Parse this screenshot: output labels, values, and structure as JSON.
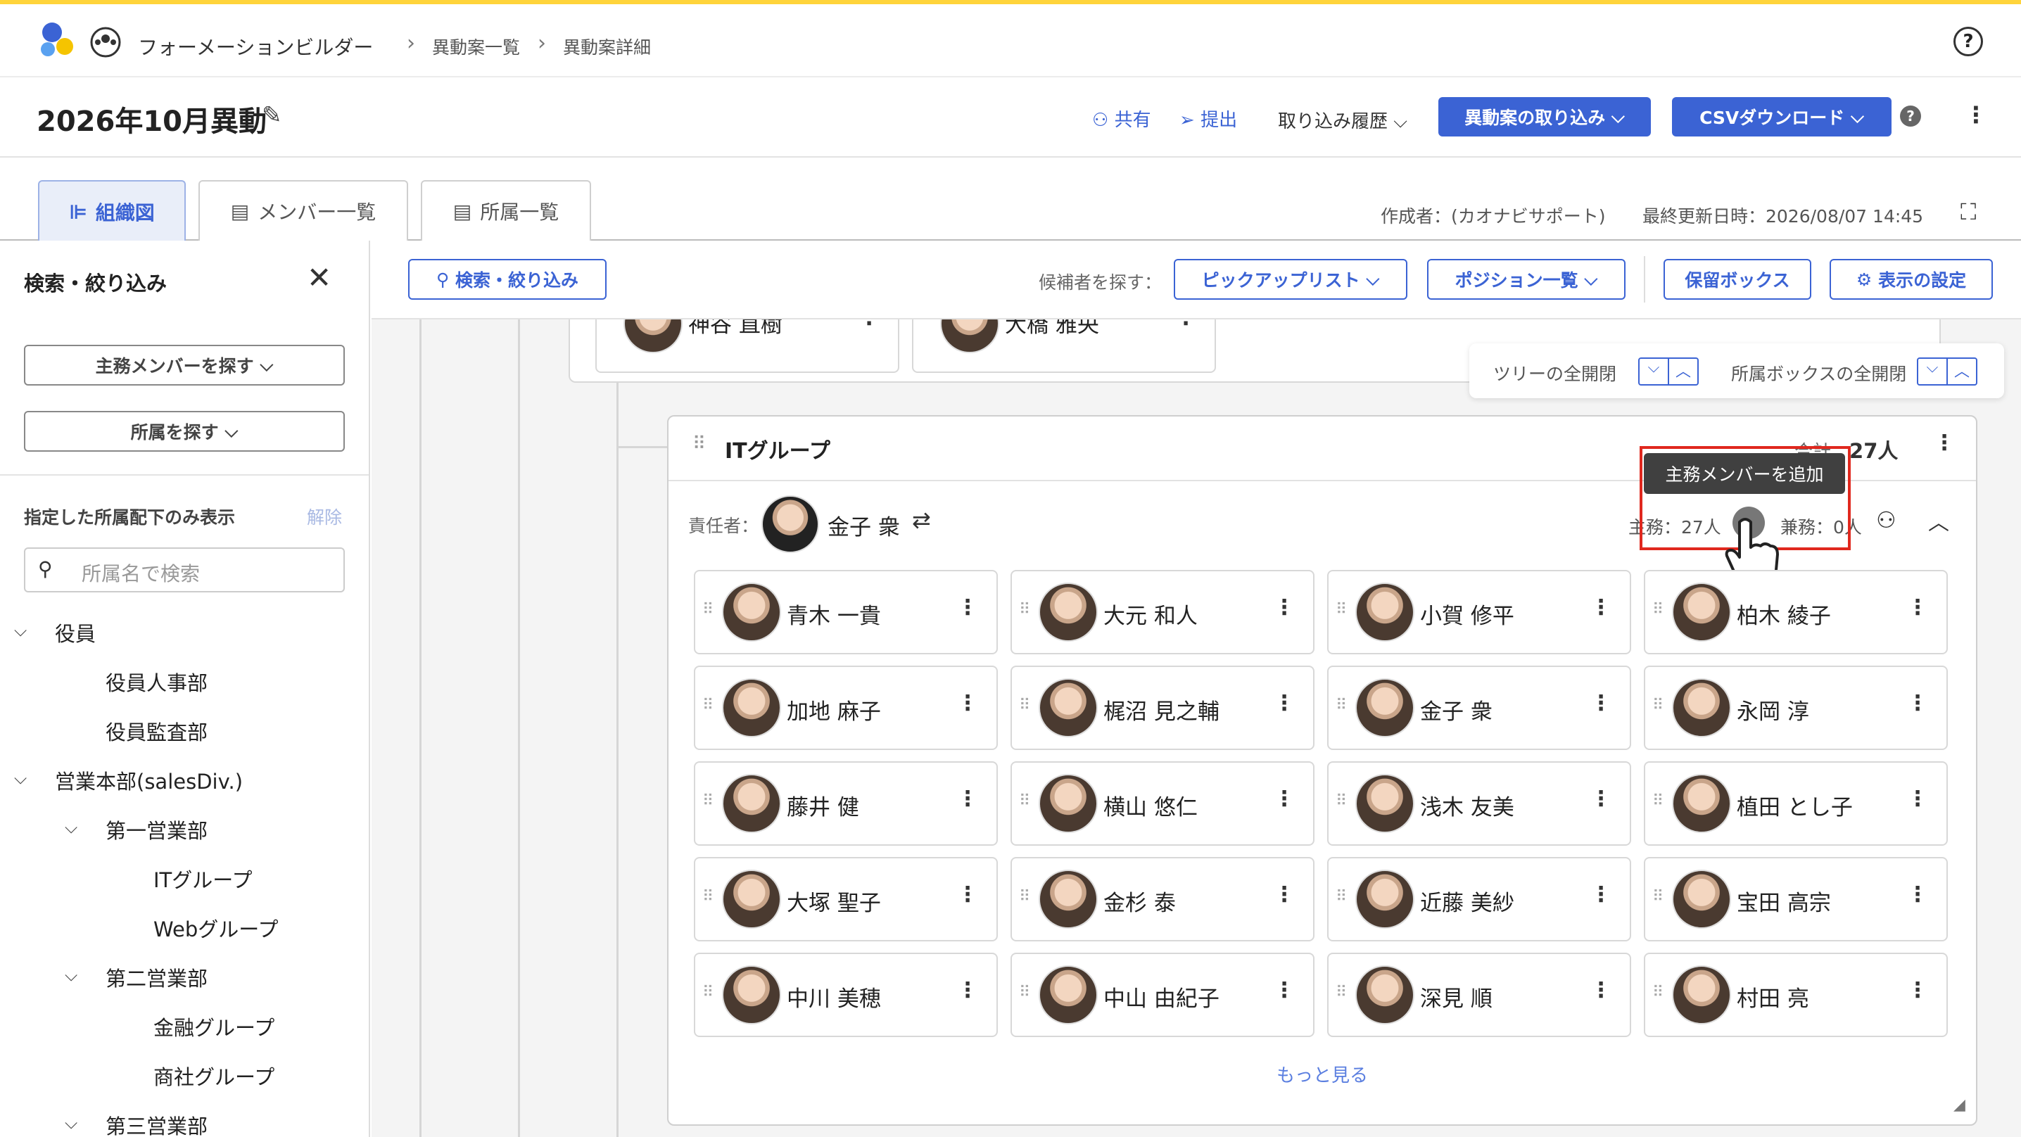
{
  "breadcrumb": {
    "app": "フォーメーションビルダー",
    "list": "異動案一覧",
    "detail": "異動案詳細"
  },
  "title": "2026年10月異動",
  "actions": {
    "share": "共有",
    "submit": "提出",
    "import_history": "取り込み履歴",
    "import_plan": "異動案の取り込み",
    "csv": "CSVダウンロード"
  },
  "tabs": [
    "組織図",
    "メンバー一覧",
    "所属一覧"
  ],
  "meta": {
    "author": "作成者：(カオナビサポート)",
    "updated": "最終更新日時：2026/08/07 14:45"
  },
  "sidebar": {
    "title": "検索・絞り込み",
    "find_member": "主務メンバーを探す",
    "find_dept": "所属を探す",
    "filter_label": "指定した所属配下のみ表示",
    "clear": "解除",
    "search_placeholder": "所属名で検索",
    "tree": [
      "役員",
      "役員人事部",
      "役員監査部",
      "営業本部(salesDiv.)",
      "第一営業部",
      "ITグループ",
      "Webグループ",
      "第二営業部",
      "金融グループ",
      "商社グループ",
      "第三営業部"
    ]
  },
  "toolbar": {
    "search": "検索・絞り込み",
    "candidates": "候補者を探す：",
    "pickup": "ピックアップリスト",
    "positions": "ポジション一覧",
    "hold": "保留ボックス",
    "display": "表示の設定"
  },
  "expand": {
    "tree": "ツリーの全開閉",
    "boxes": "所属ボックスの全開閉"
  },
  "top_members": [
    "神谷 直樹",
    "大橋 雅央"
  ],
  "group": {
    "name": "ITグループ",
    "total_label": "合計：",
    "total": "27人",
    "leader_label": "責任者：",
    "leader": "金子 衆",
    "main_label": "主務：27人",
    "side_label": "兼務：0人",
    "tooltip": "主務メンバーを追加",
    "more": "もっと見る",
    "members": [
      "青木 一貴",
      "大元 和人",
      "小賀 修平",
      "柏木 綾子",
      "加地 麻子",
      "梶沼 見之輔",
      "金子 衆",
      "永岡 淳",
      "藤井 健",
      "横山 悠仁",
      "浅木 友美",
      "植田 とし子",
      "大塚 聖子",
      "金杉 泰",
      "近藤 美紗",
      "宝田 高宗",
      "中川 美穂",
      "中山 由紀子",
      "深見 順",
      "村田 亮"
    ]
  },
  "colors": {
    "accent": "#3b63d4",
    "highlight": "#e0281e",
    "topline": "#ffd43b"
  }
}
